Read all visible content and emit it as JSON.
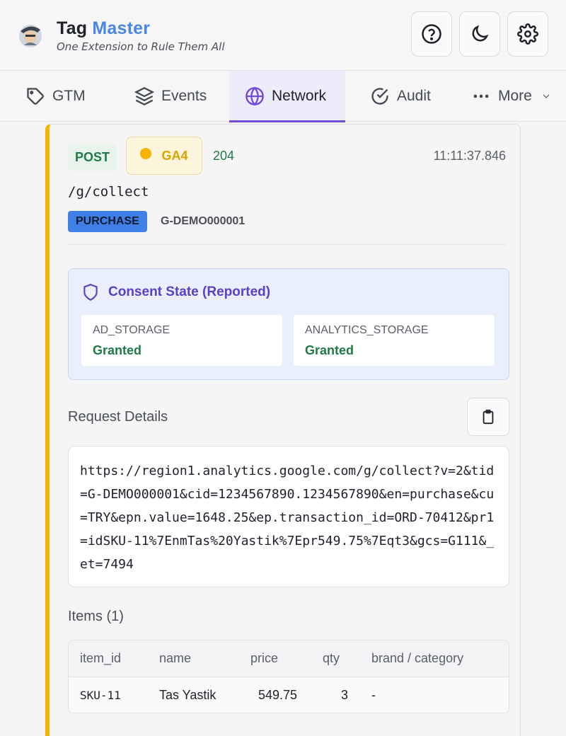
{
  "header": {
    "brand_first": "Tag",
    "brand_second": "Master",
    "subtitle": "One Extension to Rule Them All",
    "icons": [
      "help-icon",
      "moon-icon",
      "gear-icon"
    ]
  },
  "tabs": [
    {
      "label": "GTM",
      "icon": "tag-icon"
    },
    {
      "label": "Events",
      "icon": "layers-icon"
    },
    {
      "label": "Network",
      "icon": "globe-icon",
      "active": true
    },
    {
      "label": "Audit",
      "icon": "check-circle-icon"
    },
    {
      "label": "More",
      "icon": "ellipsis-icon"
    }
  ],
  "request": {
    "method": "POST",
    "vendor": "GA4",
    "status": "204",
    "time": "11:11:37.846",
    "path": "/g/collect",
    "event": "PURCHASE",
    "measurement_id": "G-DEMO000001",
    "accent_color": "#f4b400"
  },
  "consent": {
    "title": "Consent State (Reported)",
    "items": [
      {
        "key": "AD_STORAGE",
        "value": "Granted"
      },
      {
        "key": "ANALYTICS_STORAGE",
        "value": "Granted"
      }
    ]
  },
  "details": {
    "title": "Request Details",
    "url": "https://region1.analytics.google.com/g/collect?v=2&tid=G-DEMO000001&cid=1234567890.1234567890&en=purchase&cu=TRY&epn.value=1648.25&ep.transaction_id=ORD-70412&pr1=idSKU-11%7EnmTas%20Yastik%7Epr549.75%7Eqt3&gcs=G111&_et=7494"
  },
  "items": {
    "title": "Items (1)",
    "columns": [
      "item_id",
      "name",
      "price",
      "qty",
      "brand / category"
    ],
    "rows": [
      {
        "item_id": "SKU-11",
        "name": "Tas Yastik",
        "price": "549.75",
        "qty": "3",
        "brand": "-"
      }
    ]
  }
}
